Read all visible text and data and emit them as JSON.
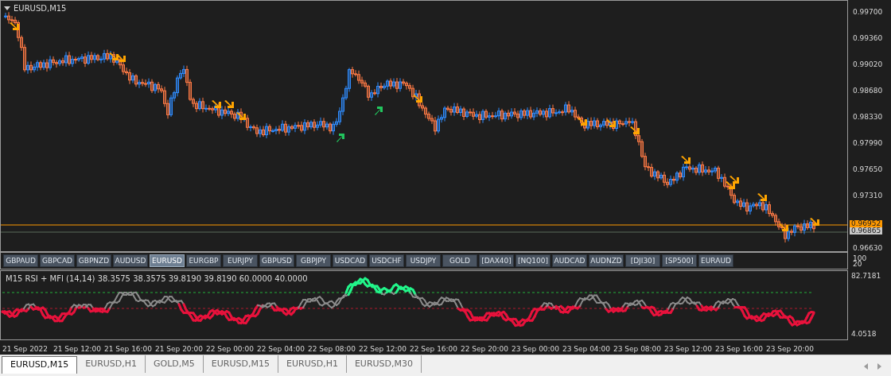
{
  "chart": {
    "title": "EURUSD,M15",
    "price_axis": [
      "0.99700",
      "0.99360",
      "0.99020",
      "0.98680",
      "0.98330",
      "0.97990",
      "0.97650",
      "0.97310",
      "0.96630"
    ],
    "price_tags": [
      {
        "kind": "bid",
        "text": "0.96952"
      },
      {
        "kind": "last",
        "text": "0.96865"
      }
    ]
  },
  "symbol_buttons": [
    {
      "label": "GBPAUD",
      "selected": false
    },
    {
      "label": "GBPCAD",
      "selected": false
    },
    {
      "label": "GBPNZD",
      "selected": false
    },
    {
      "label": "AUDUSD",
      "selected": false
    },
    {
      "label": "EURUSD",
      "selected": true
    },
    {
      "label": "EURGBP",
      "selected": false
    },
    {
      "label": "EURJPY",
      "selected": false
    },
    {
      "label": "GBPUSD",
      "selected": false
    },
    {
      "label": "GBPJPY",
      "selected": false
    },
    {
      "label": "USDCAD",
      "selected": false
    },
    {
      "label": "USDCHF",
      "selected": false
    },
    {
      "label": "USDJPY",
      "selected": false
    },
    {
      "label": "GOLD",
      "selected": false
    },
    {
      "label": "[DAX40]",
      "selected": false
    },
    {
      "label": "[NQ100]",
      "selected": false
    },
    {
      "label": "AUDCAD",
      "selected": false
    },
    {
      "label": "AUDNZD",
      "selected": false
    },
    {
      "label": "[DJI30]",
      "selected": false
    },
    {
      "label": "[SP500]",
      "selected": false
    },
    {
      "label": "EURAUD",
      "selected": false
    }
  ],
  "button_panel_scale": [
    "100",
    "20"
  ],
  "indicator": {
    "title": "M15 RSI + MFI (14,14) 38.3575 38.3575 39.8190 39.8190 60.0000 40.0000",
    "axis": [
      "82.7181",
      "4.0518"
    ]
  },
  "time_axis": [
    "21 Sep 2022",
    "21 Sep 12:00",
    "21 Sep 16:00",
    "21 Sep 20:00",
    "22 Sep 00:00",
    "22 Sep 04:00",
    "22 Sep 08:00",
    "22 Sep 12:00",
    "22 Sep 16:00",
    "22 Sep 20:00",
    "23 Sep 00:00",
    "23 Sep 04:00",
    "23 Sep 08:00",
    "23 Sep 12:00",
    "23 Sep 16:00",
    "23 Sep 20:00"
  ],
  "tabs": [
    {
      "label": "EURUSD,M15",
      "selected": true
    },
    {
      "label": "EURUSD,H1",
      "selected": false
    },
    {
      "label": "GOLD,M5",
      "selected": false
    },
    {
      "label": "EURUSD,M15",
      "selected": false
    },
    {
      "label": "EURUSD,H1",
      "selected": false
    },
    {
      "label": "EURUSD,M30",
      "selected": false
    }
  ]
}
